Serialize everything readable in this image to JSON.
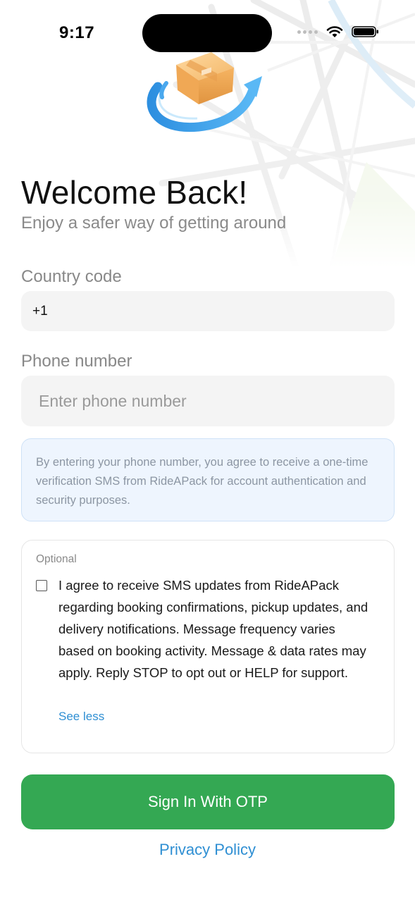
{
  "status_bar": {
    "time": "9:17",
    "icons": [
      "signal-dots-icon",
      "wifi-icon",
      "battery-icon"
    ]
  },
  "header": {
    "logo": "package-delivery-logo",
    "title": "Welcome Back!",
    "subtitle": "Enjoy a safer way of getting around"
  },
  "form": {
    "country_code": {
      "label": "Country code",
      "value": "+1"
    },
    "phone": {
      "label": "Phone number",
      "placeholder": "Enter phone number",
      "value": ""
    },
    "disclaimer": "By entering your phone number, you agree to receive a one-time verification SMS from RideAPack for account authentication and security purposes.",
    "sms_consent": {
      "section_label": "Optional",
      "checked": false,
      "text": "I agree to receive SMS updates from RideAPack regarding booking confirmations, pickup updates, and delivery notifications. Message frequency varies based on booking activity. Message & data rates may apply. Reply STOP to opt out or HELP for support.",
      "toggle_label": "See less"
    },
    "submit_label": "Sign In With OTP",
    "privacy_link": "Privacy Policy"
  },
  "colors": {
    "primary_green": "#34a853",
    "link_blue": "#2f8fd3",
    "info_bg": "#eef5fe",
    "field_bg": "#f4f4f4"
  }
}
